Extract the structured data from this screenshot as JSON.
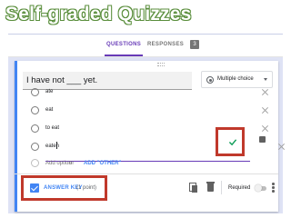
{
  "slide": {
    "title": "Self-graded Quizzes"
  },
  "topbar": {
    "tabs": [
      {
        "label": "QUESTIONS",
        "active": true
      },
      {
        "label": "RESPONSES",
        "badge": "3"
      }
    ]
  },
  "question": {
    "title": "I have not ___ yet.",
    "type": {
      "label": "Multiple choice",
      "icon": "radio-button-icon"
    },
    "options": [
      {
        "label": "ate"
      },
      {
        "label": "eat"
      },
      {
        "label": "to eat"
      },
      {
        "label": "eaten",
        "editing": true,
        "correct": true
      }
    ],
    "add_option_label": "Add option",
    "add_other_prefix": "or",
    "add_other_label": "ADD \"OTHER\""
  },
  "footer": {
    "answer_key_label": "ANSWER KEY",
    "points": "(1 point)",
    "required_label": "Required",
    "required_on": false
  },
  "colors": {
    "accent": "#673ab7",
    "link": "#4285f4",
    "correct": "#0f9d58",
    "highlight_box": "#c0392b",
    "title_outline": "#5a8e3c"
  }
}
